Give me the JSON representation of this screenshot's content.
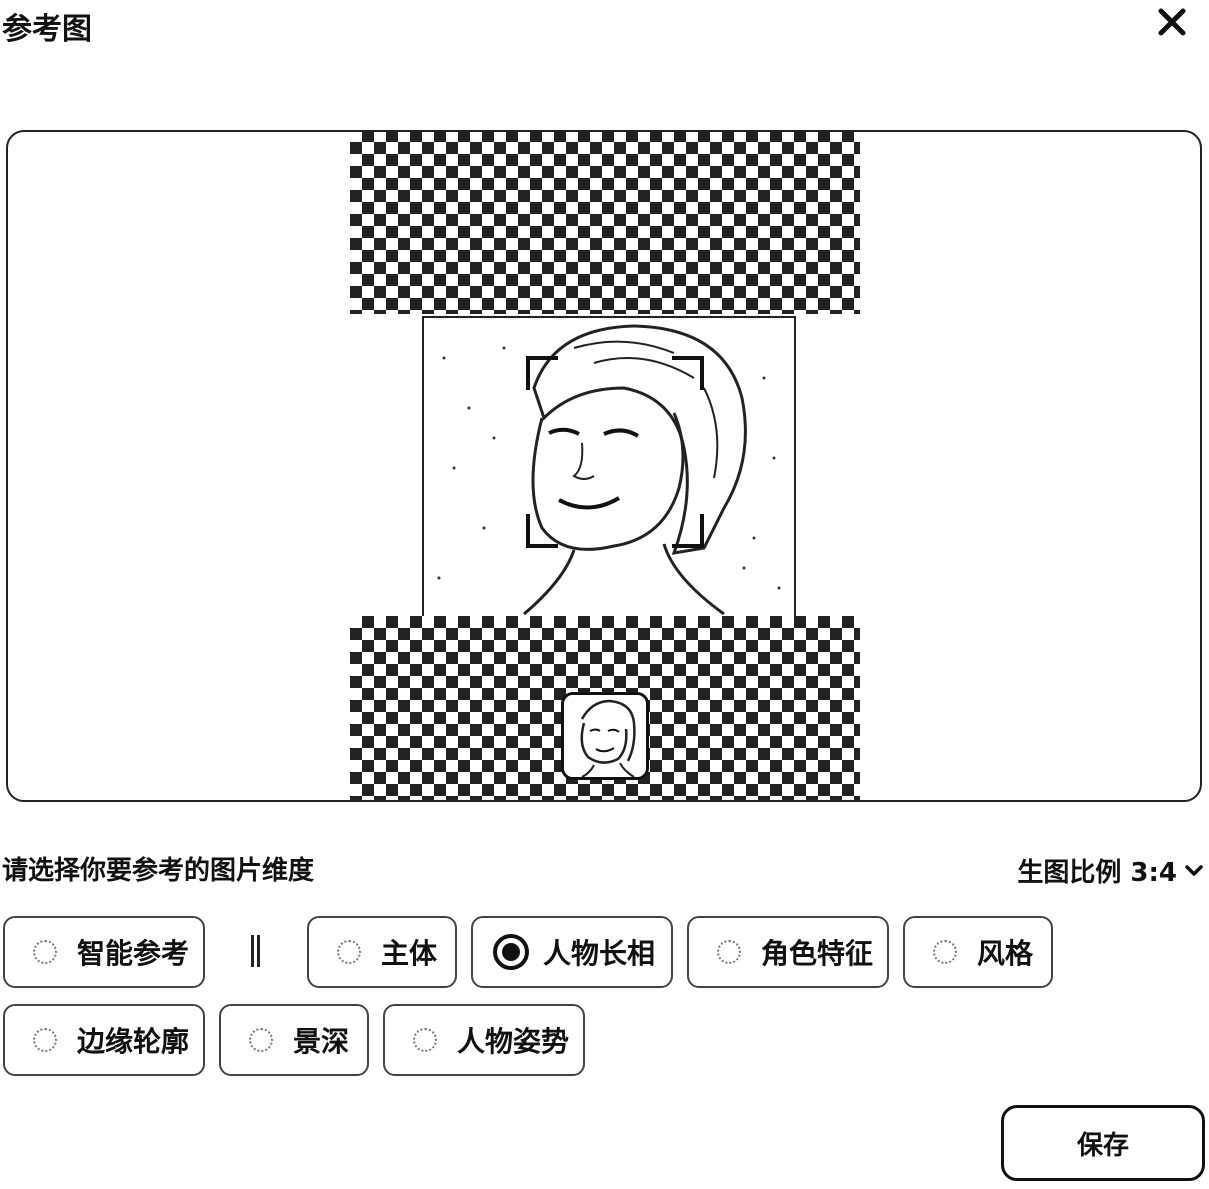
{
  "dialog": {
    "title": "参考图"
  },
  "preview": {
    "image_alt": "人物照片"
  },
  "selector": {
    "prompt": "请选择你要参考的图片维度",
    "ratio_label": "生图比例 3:4"
  },
  "options": [
    {
      "label": "智能参考",
      "selected": false
    },
    {
      "label": "主体",
      "selected": false
    },
    {
      "label": "人物长相",
      "selected": true
    },
    {
      "label": "角色特征",
      "selected": false
    },
    {
      "label": "风格",
      "selected": false
    },
    {
      "label": "边缘轮廓",
      "selected": false
    },
    {
      "label": "景深",
      "selected": false
    },
    {
      "label": "人物姿势",
      "selected": false
    }
  ],
  "footer": {
    "save_label": "保存"
  }
}
